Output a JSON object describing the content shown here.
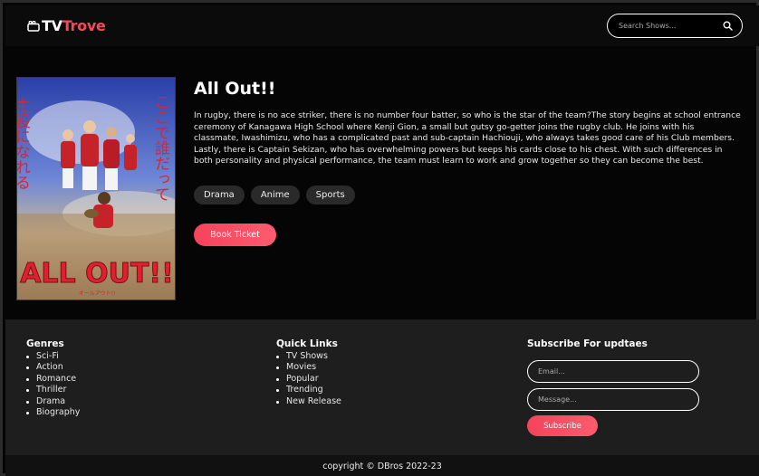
{
  "header": {
    "logo_tv": "TV",
    "logo_trove": "Trove",
    "search_placeholder": "Search Shows...",
    "icons": {
      "logo": "tv-icon",
      "search": "search-icon"
    }
  },
  "show": {
    "title": "All Out!!",
    "description": "In rugby, there is no ace striker, there is no number four batter, so who is the star of the team?The story begins at school entrance ceremony of Kanagawa High School where Kenji Gion, a small but gutsy go-getter joins the rugby club. He joins with his classmate, Iwashimizu, who has a complicated past and sub-captain Hachiouji, who always takes good care of his Club members. Lastly, there is Captain Sekizan, who has overwhelming powers but keeps his cards close to his chest. With such differences in both personality and physical performance, the team must learn to work and grow together so they can become the best.",
    "genres": [
      "Drama",
      "Anime",
      "Sports"
    ],
    "book_label": "Book Ticket",
    "poster": {
      "title_text": "ALL OUT!!",
      "subtitle_text": "オールアウト!!",
      "vertical_left": "主役になれる",
      "vertical_right": "ここで誰だって"
    }
  },
  "footer": {
    "genres_title": "Genres",
    "genres": [
      "Sci-Fi",
      "Action",
      "Romance",
      "Thriller",
      "Drama",
      "Biography"
    ],
    "quick_links_title": "Quick Links",
    "quick_links": [
      "TV Shows",
      "Movies",
      "Popular",
      "Trending",
      "New Release"
    ],
    "subscribe_title": "Subscribe For updtaes",
    "email_placeholder": "Email...",
    "message_placeholder": "Message...",
    "subscribe_label": "Subscribe",
    "copyright": "copyright © DBros 2022-23"
  },
  "colors": {
    "accent": "#f5475d",
    "background": "#050505",
    "footer": "#1e1e1e",
    "chip": "#2a2a2a"
  }
}
